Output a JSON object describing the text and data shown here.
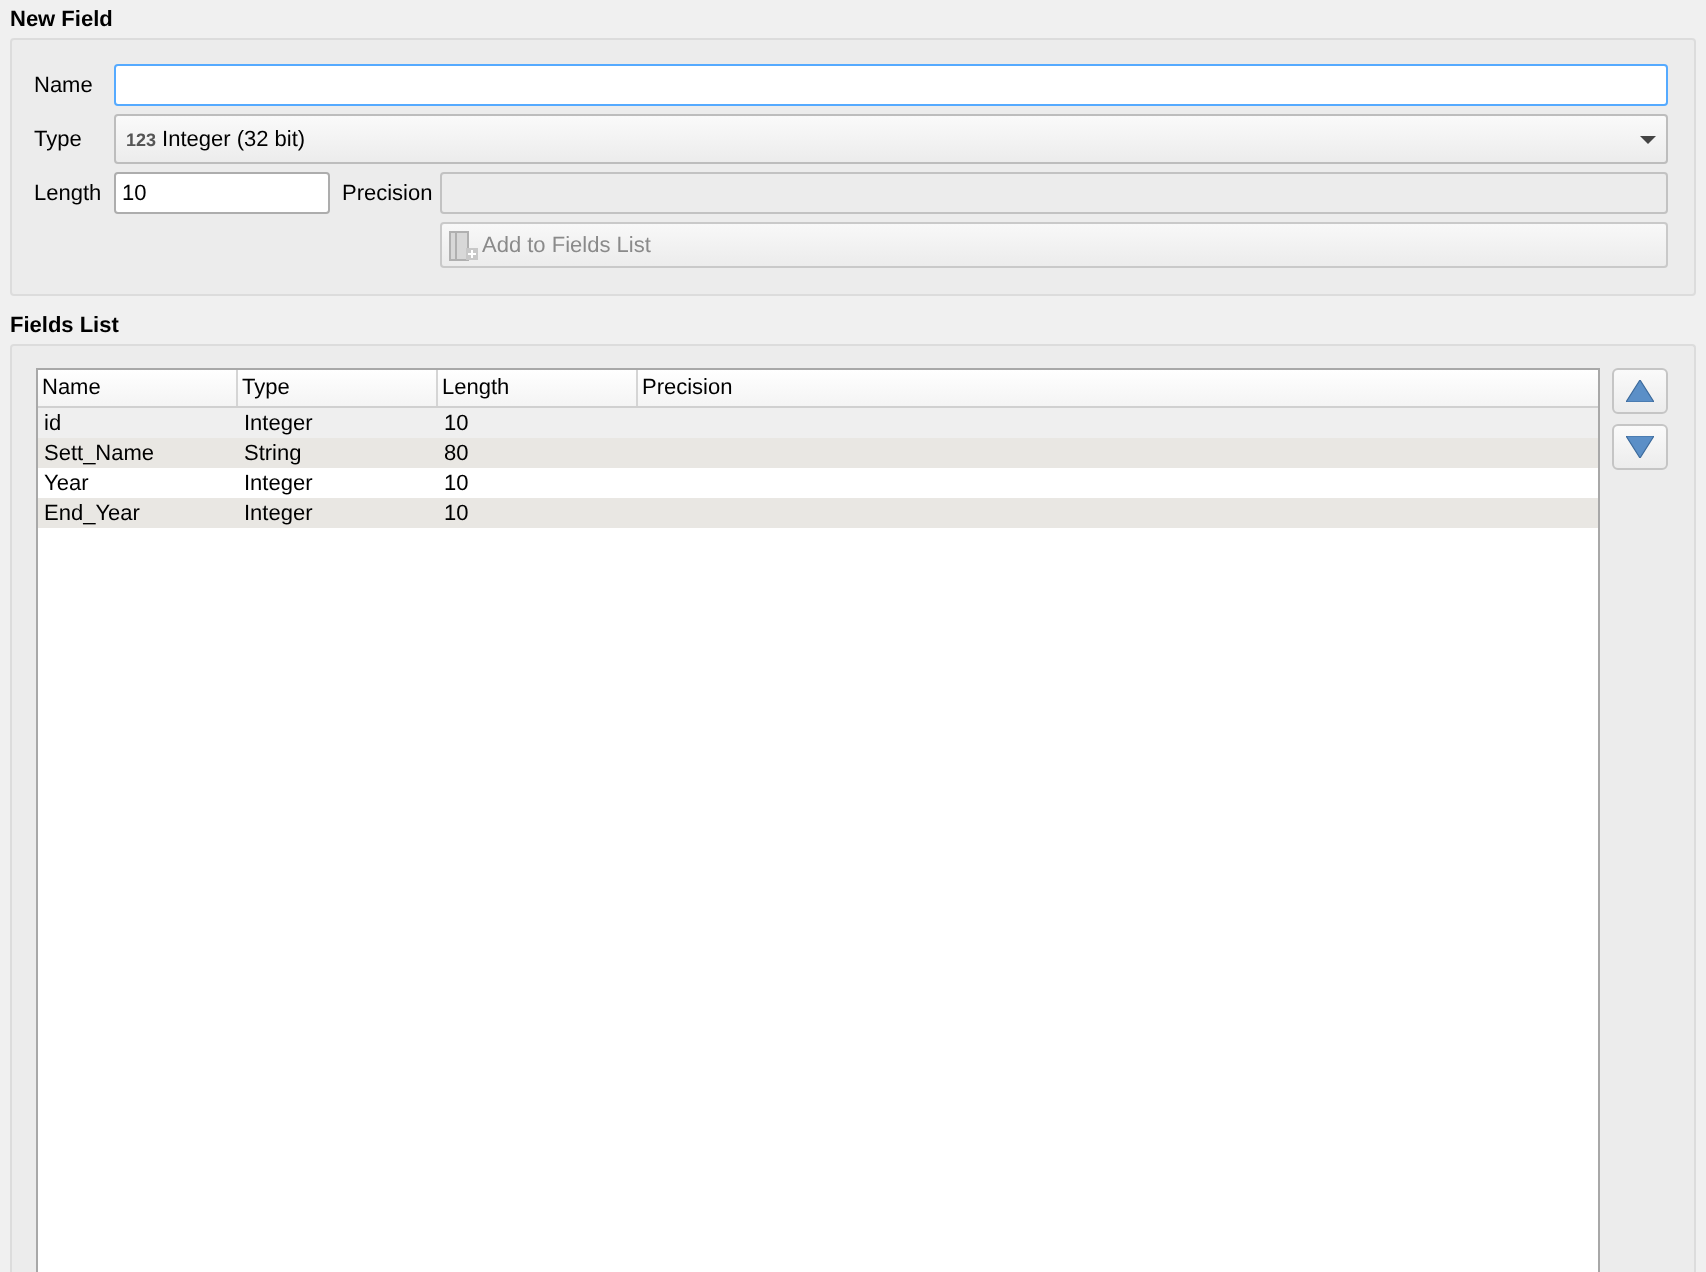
{
  "new_field": {
    "title": "New Field",
    "name": {
      "label": "Name",
      "focused": true
    },
    "type": {
      "label": "Type",
      "icon_text": "123",
      "value": "Integer (32 bit)"
    },
    "length": {
      "label": "Length",
      "value": "10"
    },
    "precision": {
      "label": "Precision",
      "disabled": true
    },
    "add_button": {
      "label": "Add to Fields List",
      "disabled": true
    }
  },
  "fields_list": {
    "title": "Fields List",
    "columns": [
      "Name",
      "Type",
      "Length",
      "Precision"
    ],
    "rows": [
      {
        "cells": [
          "id",
          "Integer",
          "10"
        ],
        "current": true
      },
      {
        "cells": [
          "Sett_Name",
          "String",
          "80"
        ],
        "current": false
      },
      {
        "cells": [
          "Year",
          "Integer",
          "10"
        ],
        "current": false
      },
      {
        "cells": [
          "End_Year",
          "Integer",
          "10"
        ],
        "current": false
      }
    ]
  }
}
